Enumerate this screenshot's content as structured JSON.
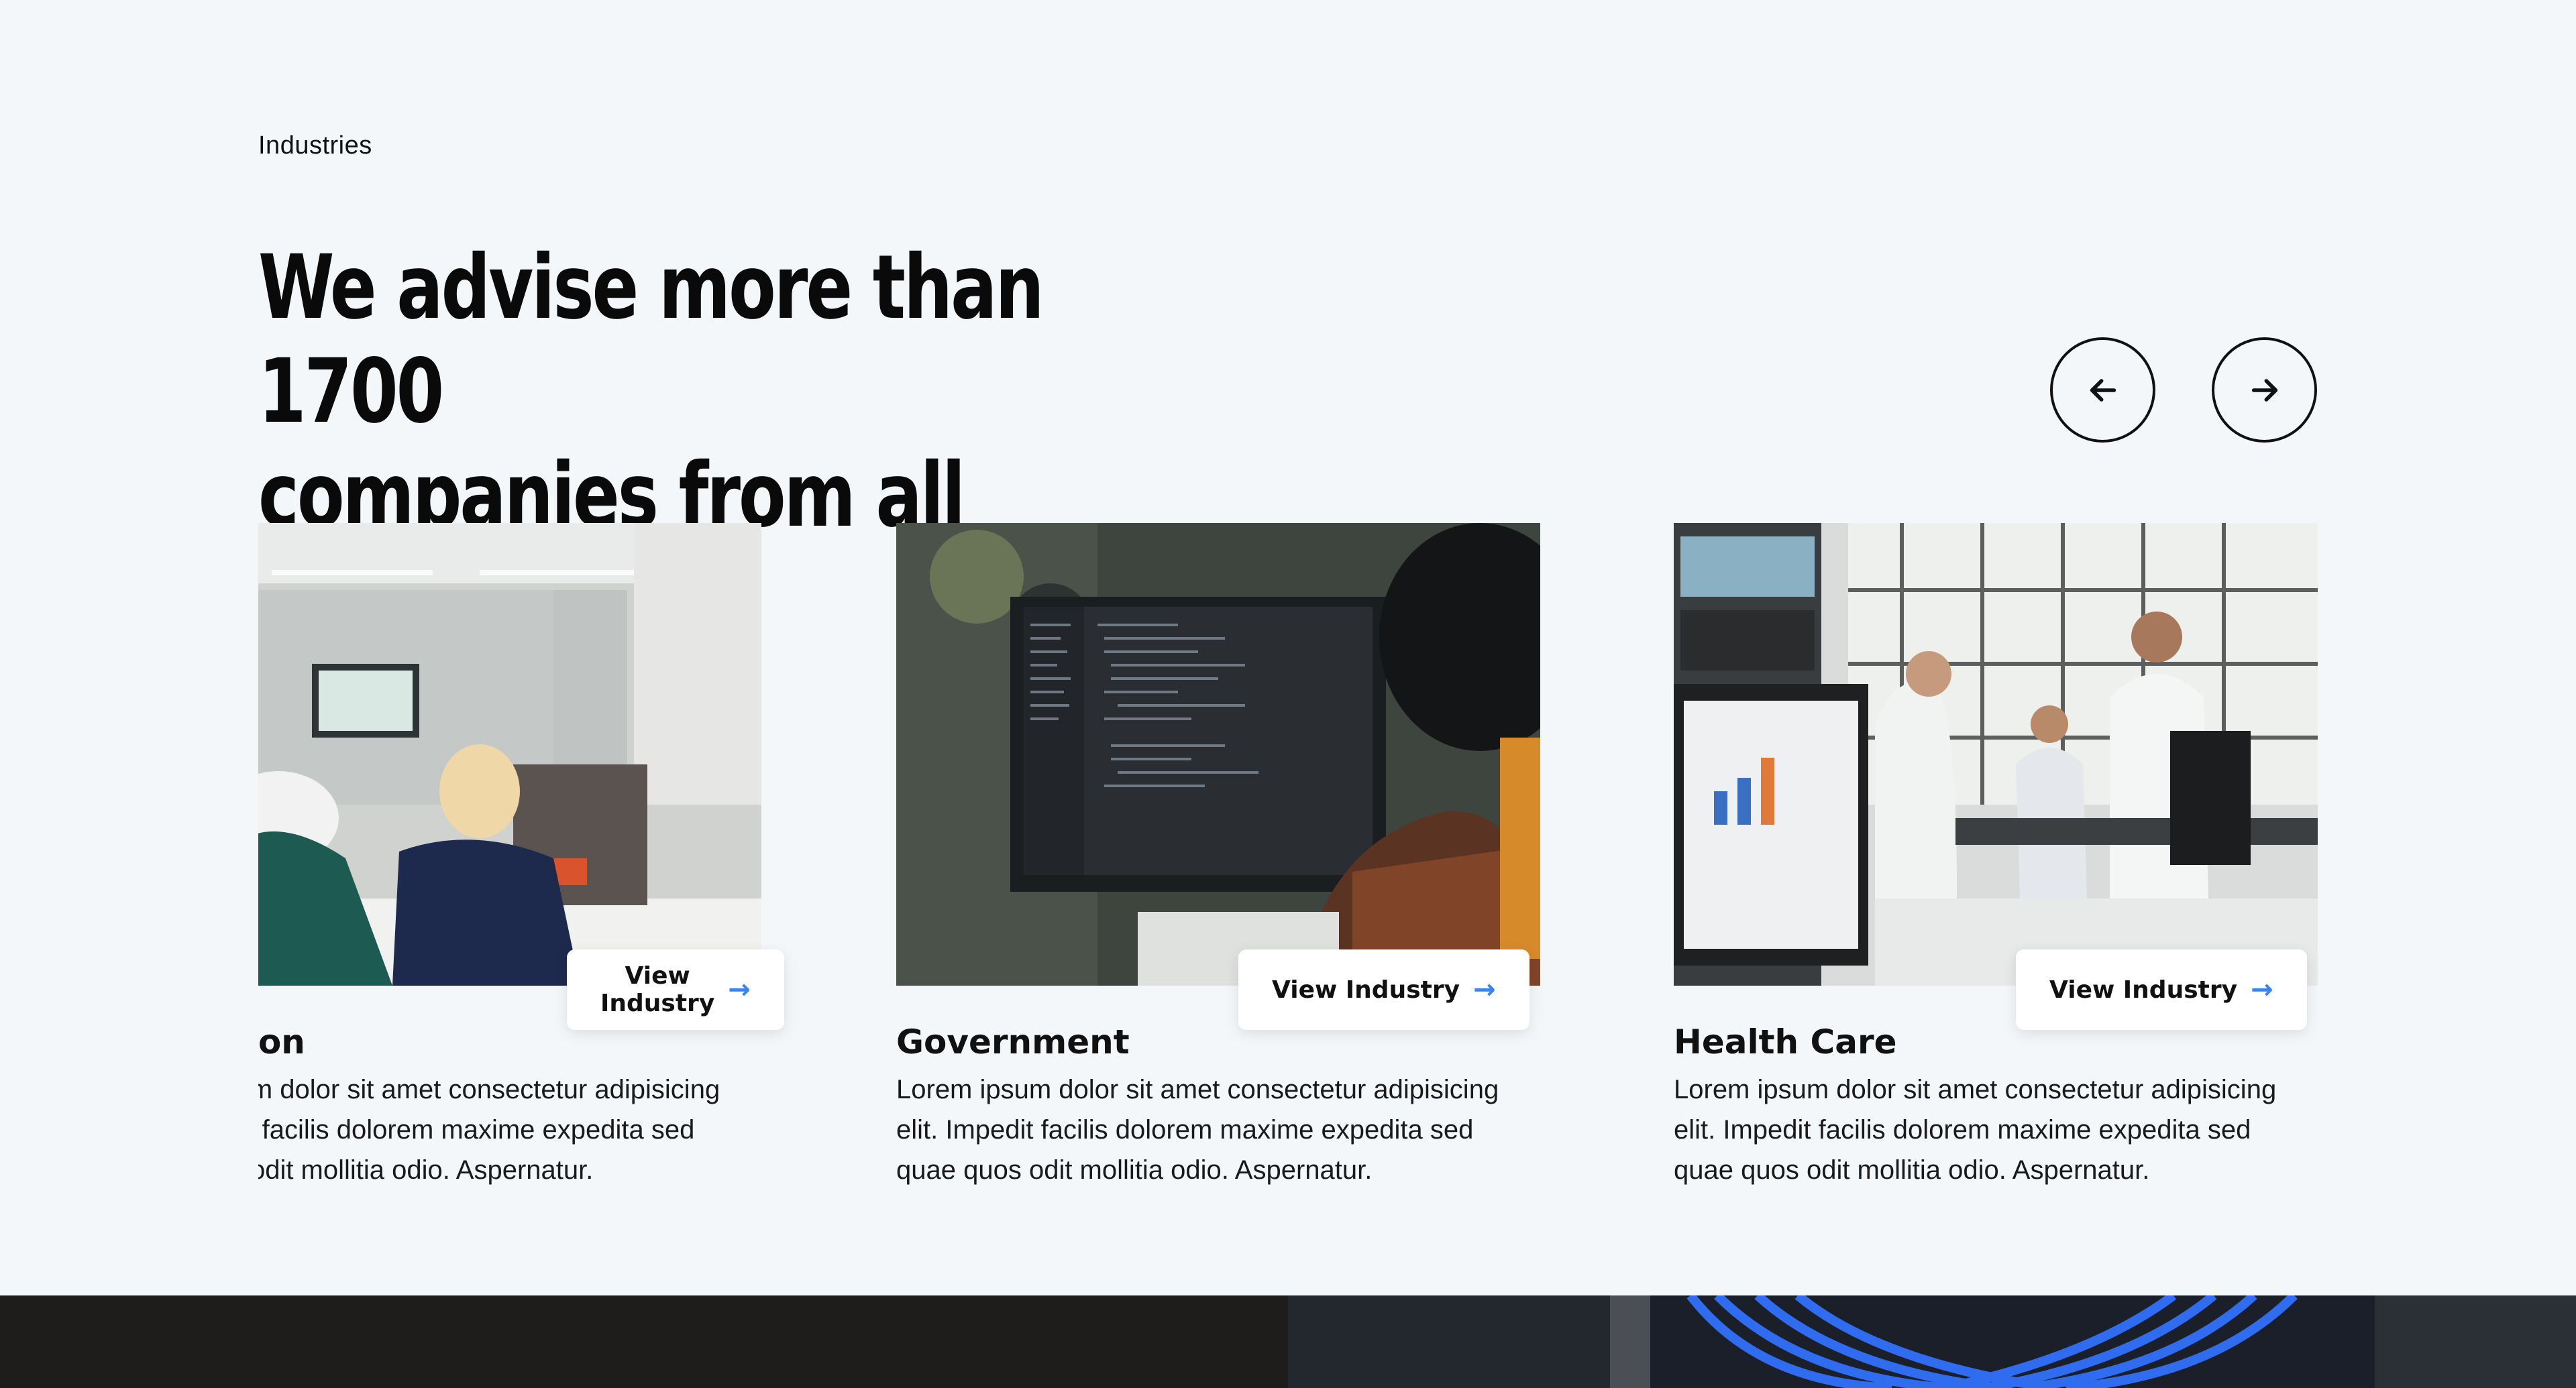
{
  "section": {
    "eyebrow": "Industries",
    "headline_line1": "We advise more than 1700",
    "headline_line2": "companies from all sectors"
  },
  "nav": {
    "prev_icon": "arrow-left-icon",
    "next_icon": "arrow-right-icon"
  },
  "cards": [
    {
      "title": "Education",
      "description": "Lorem ipsum dolor sit amet consectetur adipisicing elit. Impedit facilis dolorem maxime expedita sed quae quos odit mollitia odio. Aspernatur.",
      "button_label": "View Industry",
      "image_icon": "workshop-photo"
    },
    {
      "title": "Government",
      "description": "Lorem ipsum dolor sit amet consectetur adipisicing elit. Impedit facilis dolorem maxime expedita sed quae quos odit mollitia odio. Aspernatur.",
      "button_label": "View Industry",
      "image_icon": "code-monitor-photo"
    },
    {
      "title": "Health Care",
      "description": "Lorem ipsum dolor sit amet consectetur adipisicing elit. Impedit facilis dolorem maxime expedita sed quae quos odit mollitia odio. Aspernatur.",
      "button_label": "View Industry",
      "image_icon": "laboratory-photo"
    }
  ],
  "colors": {
    "background": "#f4f7fa",
    "accent": "#3b82f6",
    "footer": "#1f1c1c"
  }
}
